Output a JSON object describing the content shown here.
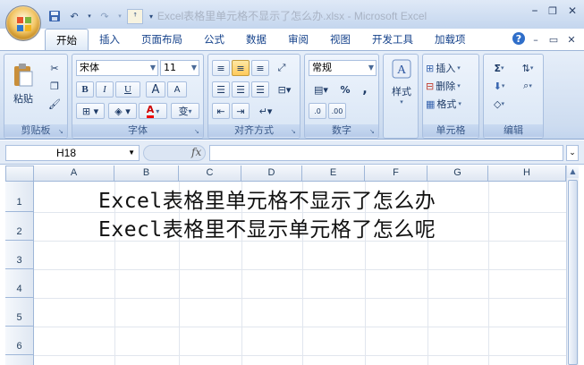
{
  "window": {
    "title": "Excel表格里单元格不显示了怎么办.xlsx - Microsoft Excel",
    "minimize_glyph": "–",
    "restore_glyph": "❐",
    "close_glyph": "✕"
  },
  "ribbon": {
    "tabs": [
      {
        "label": "开始",
        "active": true
      },
      {
        "label": "插入",
        "active": false
      },
      {
        "label": "页面布局",
        "active": false
      },
      {
        "label": "公式",
        "active": false
      },
      {
        "label": "数据",
        "active": false
      },
      {
        "label": "审阅",
        "active": false
      },
      {
        "label": "视图",
        "active": false
      },
      {
        "label": "开发工具",
        "active": false
      },
      {
        "label": "加载项",
        "active": false
      }
    ],
    "help_glyph": "?",
    "groups": {
      "clipboard": {
        "label": "剪贴板",
        "paste_label": "粘贴"
      },
      "font": {
        "label": "字体",
        "font_name": "宋体",
        "font_size": "11",
        "bold": "B",
        "italic": "I",
        "underline": "U",
        "grow": "A",
        "shrink": "A",
        "font_color_glyph": "A",
        "phonetic": "变"
      },
      "alignment": {
        "label": "对齐方式"
      },
      "number": {
        "label": "数字",
        "format": "常规",
        "percent": "%",
        "comma": ","
      },
      "styles": {
        "label": "样式"
      },
      "cells": {
        "label": "单元格",
        "insert": "插入",
        "delete": "删除",
        "format": "格式"
      },
      "editing": {
        "label": "编辑",
        "sum_glyph": "Σ"
      }
    },
    "accent": "#15428b"
  },
  "formula_bar": {
    "name_box": "H18",
    "fx": "fx",
    "value": ""
  },
  "sheet": {
    "columns": [
      "A",
      "B",
      "C",
      "D",
      "E",
      "F",
      "G",
      "H"
    ],
    "rows": [
      "1",
      "2",
      "3",
      "4",
      "5",
      "6"
    ],
    "cells": {
      "line1": "Excel表格里单元格不显示了怎么办",
      "line2": "Execl表格里不显示单元格了怎么呢"
    }
  }
}
